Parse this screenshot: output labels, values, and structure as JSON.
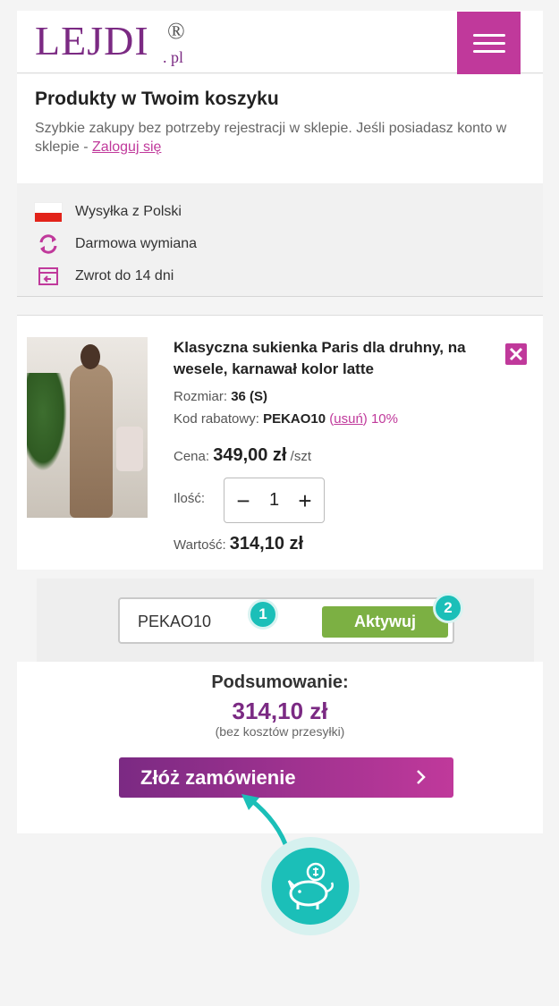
{
  "header": {
    "logo_text": "LEJDI",
    "logo_reg": "®",
    "logo_pl": ". pl"
  },
  "intro": {
    "title": "Produkty w Twoim koszyku",
    "text": "Szybkie zakupy bez potrzeby rejestracji w sklepie. Jeśli posiadasz konto w sklepie - ",
    "login_link": "Zaloguj się"
  },
  "perks": [
    {
      "icon": "poland-flag-icon",
      "label": "Wysyłka z Polski"
    },
    {
      "icon": "exchange-icon",
      "label": "Darmowa wymiana"
    },
    {
      "icon": "return-box-icon",
      "label": "Zwrot do 14 dni"
    }
  ],
  "product": {
    "title": "Klasyczna sukienka Paris dla druhny, na wesele, karnawał kolor latte",
    "size_label": "Rozmiar:",
    "size_value": "36 (S)",
    "coupon_label": "Kod rabatowy:",
    "coupon_value": "PEKAO10",
    "remove_open": "(",
    "remove_link": "usuń",
    "remove_close": ")",
    "discount": "10%",
    "price_label": "Cena:",
    "price_value": "349,00 zł",
    "price_unit": "/szt",
    "qty_label": "Ilość:",
    "qty_minus": "−",
    "qty_value": "1",
    "qty_plus": "+",
    "total_label": "Wartość:",
    "total_value": "314,10 zł"
  },
  "coupon": {
    "value": "PEKAO10",
    "button": "Aktywuj",
    "badge1": "1",
    "badge2": "2"
  },
  "summary": {
    "label": "Podsumowanie:",
    "total": "314,10 zł",
    "note": "(bez kosztów przesyłki)",
    "order_button": "Złóż zamówienie"
  },
  "colors": {
    "brand_purple": "#7b2a83",
    "brand_pink": "#c0399b",
    "accent_green": "#7cb043",
    "accent_teal": "#1bbfb8"
  }
}
